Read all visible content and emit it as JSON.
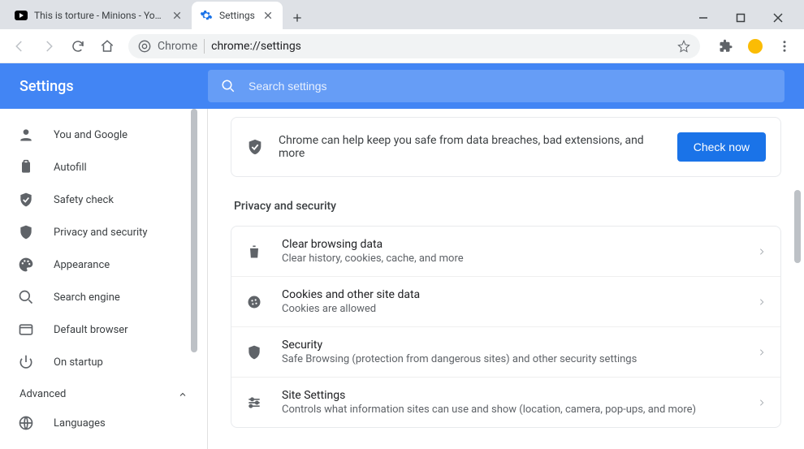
{
  "window": {
    "tabs": [
      {
        "title": "This is torture - Minions - YouTu",
        "favicon": "youtube",
        "active": false
      },
      {
        "title": "Settings",
        "favicon": "gear",
        "active": true
      }
    ]
  },
  "omnibox": {
    "scheme_label": "Chrome",
    "url": "chrome://settings"
  },
  "header": {
    "title": "Settings"
  },
  "search": {
    "placeholder": "Search settings"
  },
  "sidebar": {
    "items": [
      {
        "icon": "person",
        "label": "You and Google"
      },
      {
        "icon": "clipboard",
        "label": "Autofill"
      },
      {
        "icon": "shield-check",
        "label": "Safety check"
      },
      {
        "icon": "shield",
        "label": "Privacy and security"
      },
      {
        "icon": "palette",
        "label": "Appearance"
      },
      {
        "icon": "magnify",
        "label": "Search engine"
      },
      {
        "icon": "browser",
        "label": "Default browser"
      },
      {
        "icon": "power",
        "label": "On startup"
      }
    ],
    "advanced_label": "Advanced",
    "advanced_items": [
      {
        "icon": "globe",
        "label": "Languages"
      }
    ]
  },
  "safety_banner": {
    "message": "Chrome can help keep you safe from data breaches, bad extensions, and more",
    "button": "Check now"
  },
  "section_title": "Privacy and security",
  "rows": [
    {
      "icon": "trash",
      "title": "Clear browsing data",
      "sub": "Clear history, cookies, cache, and more"
    },
    {
      "icon": "cookie",
      "title": "Cookies and other site data",
      "sub": "Cookies are allowed"
    },
    {
      "icon": "shield",
      "title": "Security",
      "sub": "Safe Browsing (protection from dangerous sites) and other security settings"
    },
    {
      "icon": "sliders",
      "title": "Site Settings",
      "sub": "Controls what information sites can use and show (location, camera, pop-ups, and more)"
    }
  ]
}
